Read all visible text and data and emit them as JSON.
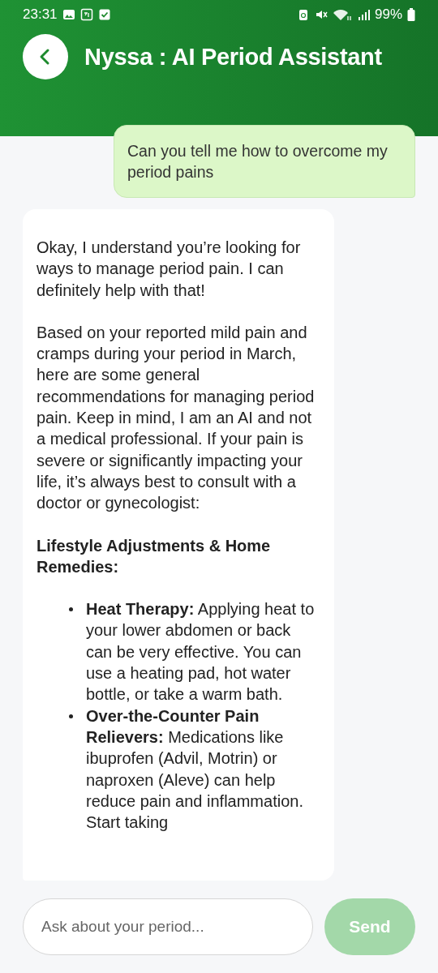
{
  "status_bar": {
    "time": "23:31",
    "battery": "99%"
  },
  "header": {
    "title": "Nyssa : AI Period Assistant"
  },
  "messages": [
    {
      "kind": "user",
      "text": "Can you tell me how to overcome my period pains"
    },
    {
      "kind": "bot",
      "blocks": [
        {
          "kind": "paragraph",
          "text": "Okay, I understand you’re looking for ways to manage period pain. I can definitely help with that!"
        },
        {
          "kind": "paragraph",
          "text": "Based on your reported mild pain and cramps during your period in March, here are some general recommendations for managing period pain. Keep in mind, I am an AI and not a medical professional. If your pain is severe or significantly impacting your life, it’s always best to consult with a doctor or gynecologist:"
        },
        {
          "kind": "heading",
          "text": "Lifestyle Adjustments & Home Remedies:"
        },
        {
          "kind": "bullet",
          "text": "**Heat Therapy:** Applying heat to your lower abdomen or back can be very effective. You can use a heating pad, hot water bottle, or take a warm bath."
        },
        {
          "kind": "bullet",
          "text": "**Over-the-Counter Pain Relievers:** Medications like ibuprofen (Advil, Motrin) or naproxen (Aleve) can help reduce pain and inflammation. Start taking"
        }
      ]
    }
  ],
  "composer": {
    "placeholder": "Ask about your period...",
    "send": {
      "label": "Send",
      "disabled": true
    }
  }
}
